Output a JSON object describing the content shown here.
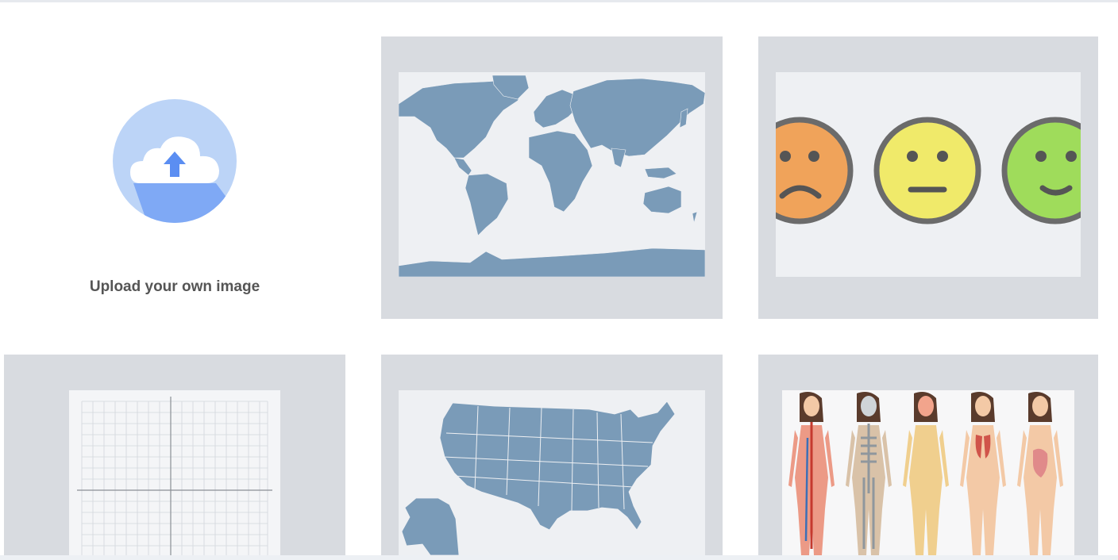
{
  "upload": {
    "label": "Upload your own image",
    "icon": "cloud-upload-icon"
  },
  "templates": [
    {
      "name": "world-map",
      "icon": "world-map-image"
    },
    {
      "name": "emotion-faces",
      "icon": "emotion-faces-image"
    },
    {
      "name": "coordinate-grid",
      "icon": "coordinate-grid-image"
    },
    {
      "name": "us-map",
      "icon": "us-map-image"
    },
    {
      "name": "human-anatomy",
      "icon": "human-anatomy-image"
    }
  ],
  "colors": {
    "tile_bg": "#d8dbe0",
    "inner_bg": "#eef0f3",
    "map_fill": "#7a9bb8",
    "upload_circle": "#bcd4f7",
    "upload_accent": "#5b8ef2",
    "face_sad": "#f0a35a",
    "face_neutral": "#f0ea6a",
    "face_happy": "#9fdc5b"
  }
}
